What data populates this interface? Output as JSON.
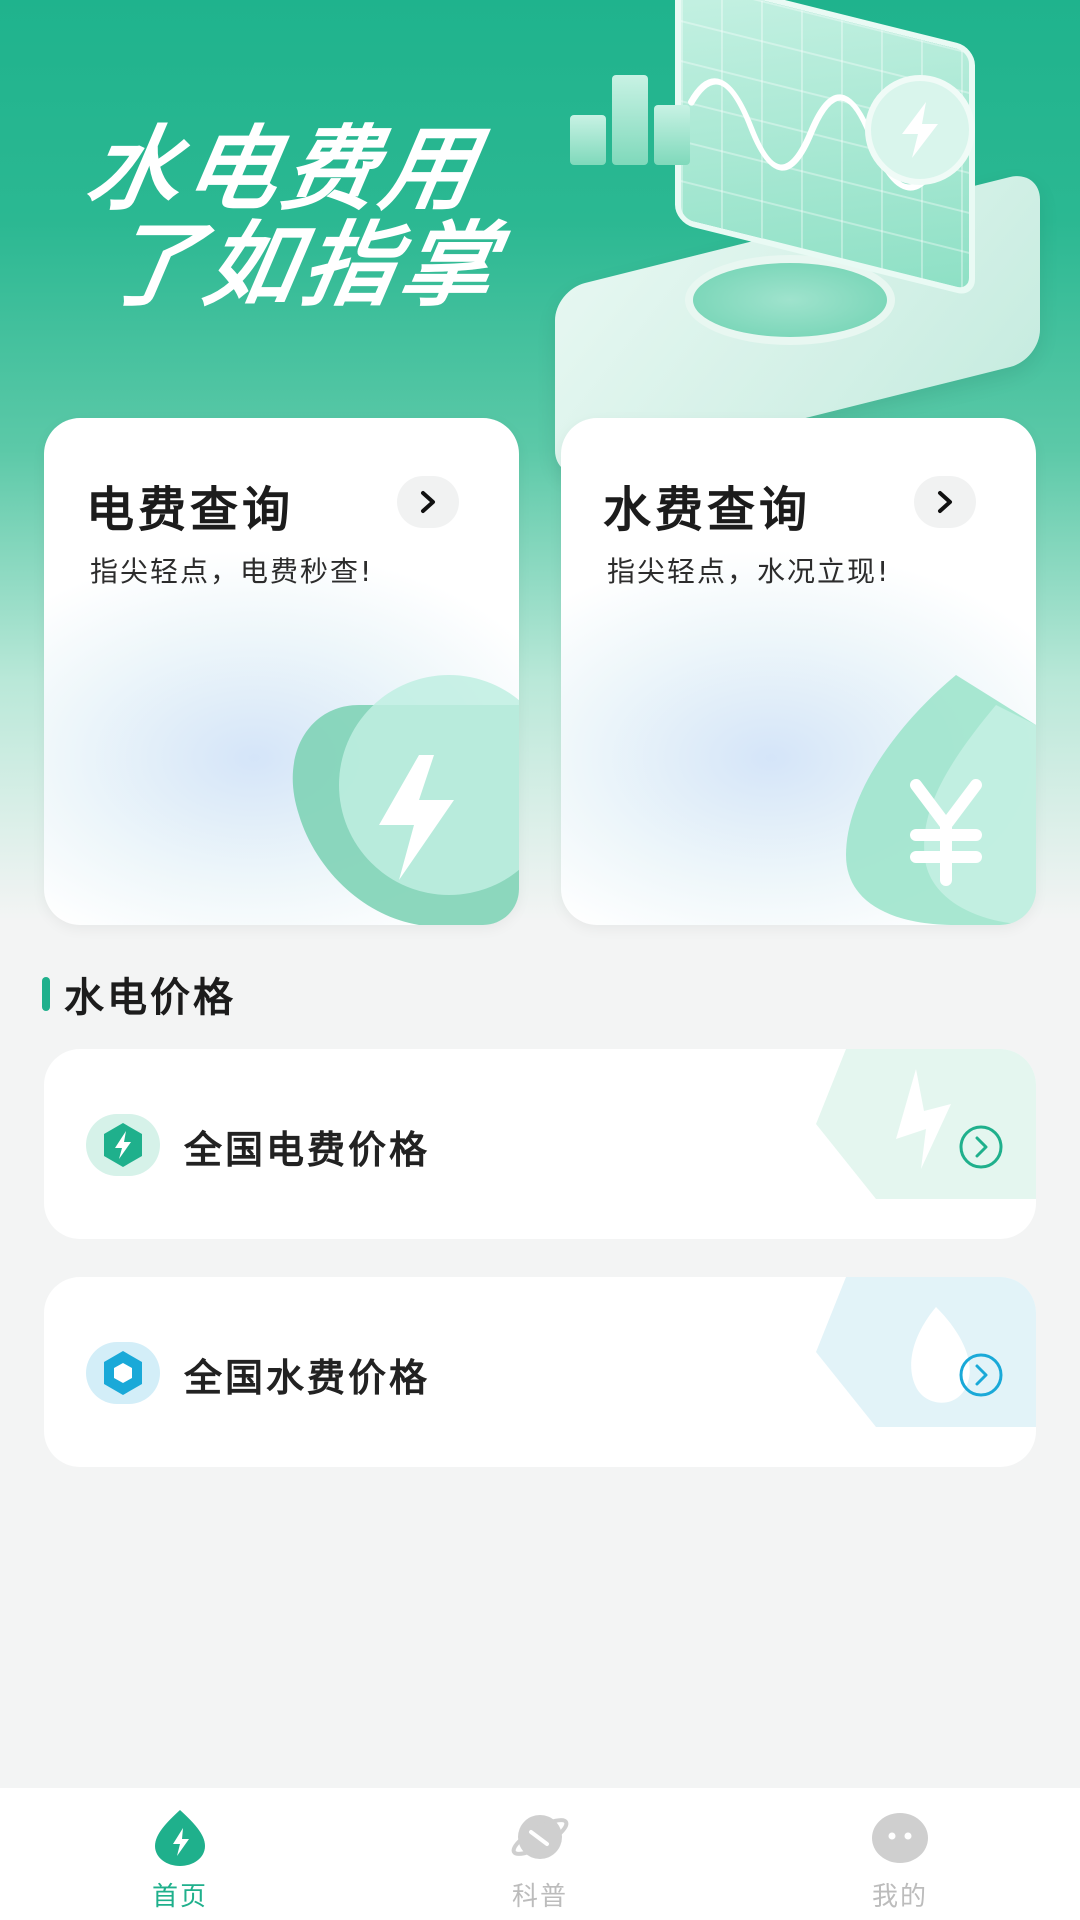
{
  "hero": {
    "title_line1": "水电费用",
    "title_line2": "了如指掌"
  },
  "cards": {
    "electricity": {
      "title": "电费查询",
      "subtitle": "指尖轻点，电费秒查!",
      "icon": "lightning-icon"
    },
    "water": {
      "title": "水费查询",
      "subtitle": "指尖轻点，水况立现!",
      "icon": "yen-icon"
    }
  },
  "section": {
    "title": "水电价格"
  },
  "price_list": [
    {
      "label": "全国电费价格",
      "icon": "lightning-hexagon-icon",
      "color": "#1fb08c"
    },
    {
      "label": "全国水费价格",
      "icon": "water-hexagon-icon",
      "color": "#1aa9d8"
    }
  ],
  "tabbar": {
    "items": [
      {
        "label": "首页",
        "icon": "home-lightning-icon",
        "active": true
      },
      {
        "label": "科普",
        "icon": "planet-icon",
        "active": false
      },
      {
        "label": "我的",
        "icon": "profile-face-icon",
        "active": false
      }
    ]
  },
  "colors": {
    "accent": "#1fb08c",
    "accent_water": "#1aa9d8",
    "inactive": "#bcbcbc"
  }
}
